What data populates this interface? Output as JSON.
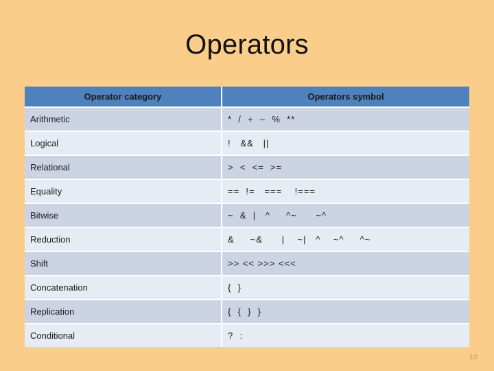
{
  "slide": {
    "title": "Operators",
    "page_number": "10",
    "background_color": "#fbcd8a",
    "header_color": "#4f81bd",
    "band_dark_color": "#ccd4e4",
    "band_light_color": "#e7ebf3"
  },
  "table": {
    "headers": [
      "Operator category",
      "Operators symbol"
    ],
    "rows": [
      {
        "category": "Arithmetic",
        "symbols": "*  /  +  –  %  **"
      },
      {
        "category": "Logical",
        "symbols": "!   &&   ||"
      },
      {
        "category": "Relational",
        "symbols": ">  <  <=  >="
      },
      {
        "category": "Equality",
        "symbols": "==  !=   ===    !==="
      },
      {
        "category": "Bitwise",
        "symbols": "~  &  |   ^     ^~      ~^"
      },
      {
        "category": "Reduction",
        "symbols": "&     ~&      |    ~|   ^    ~^     ^~"
      },
      {
        "category": "Shift",
        "symbols": ">> << >>> <<<"
      },
      {
        "category": "Concatenation",
        "symbols": "{  }"
      },
      {
        "category": "Replication",
        "symbols": "{  {  }  }"
      },
      {
        "category": "Conditional",
        "symbols": "?  :"
      }
    ]
  }
}
